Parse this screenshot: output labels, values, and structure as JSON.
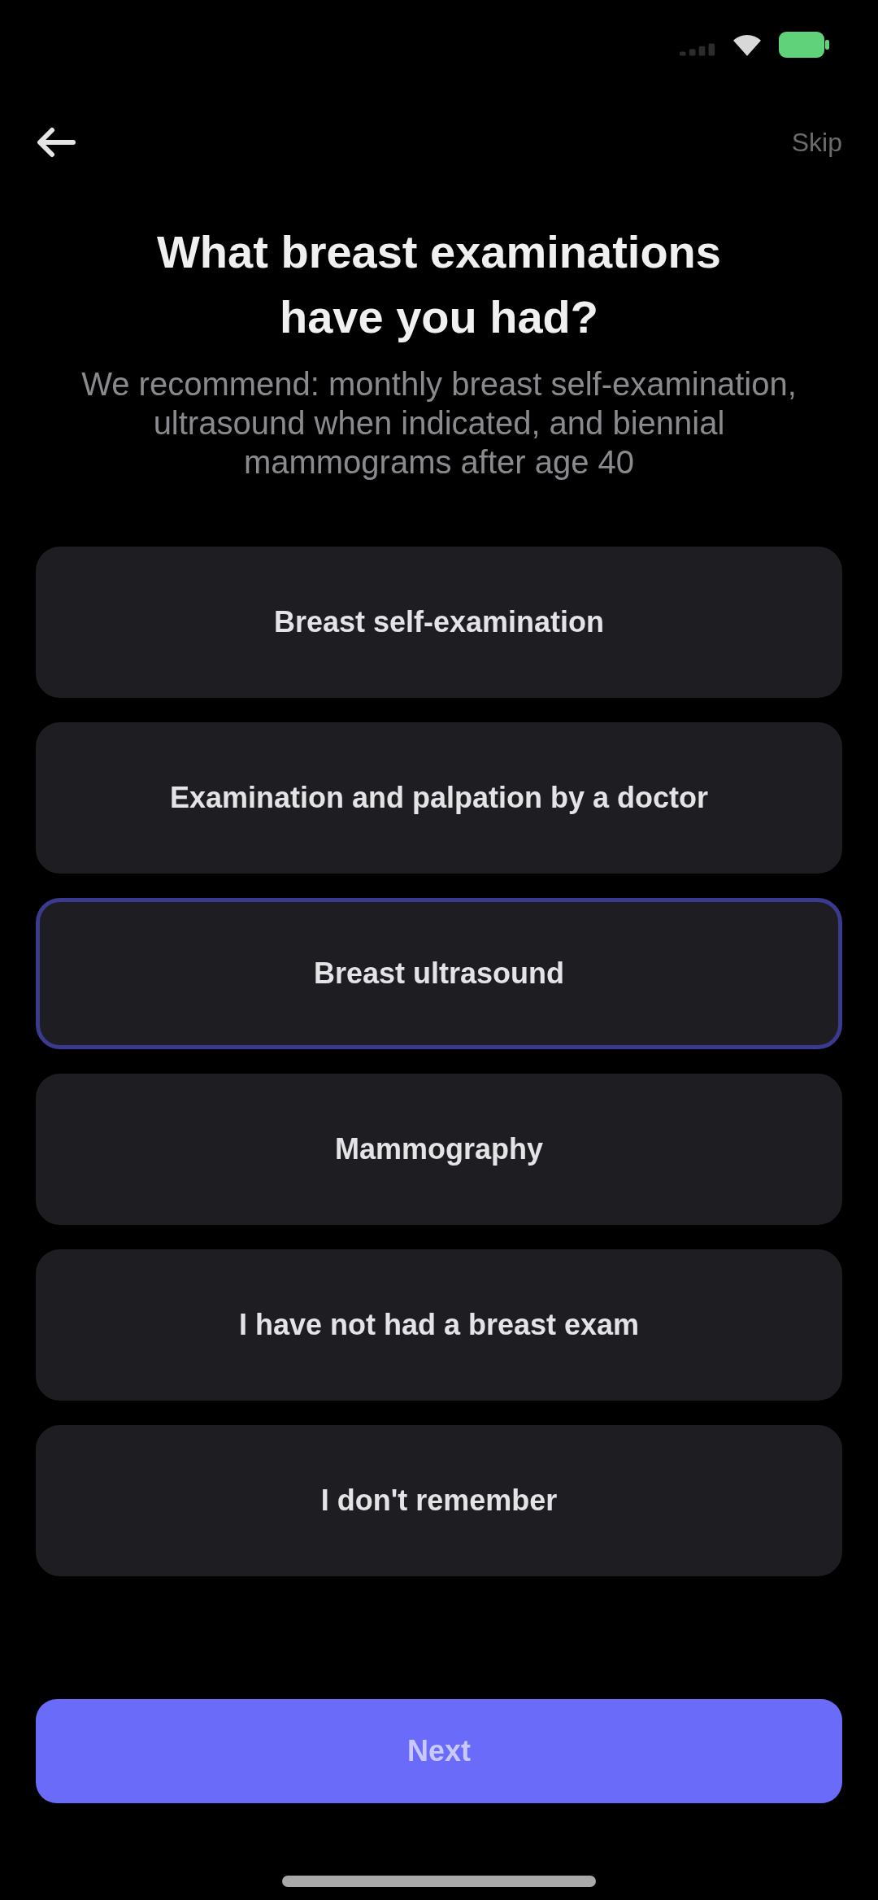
{
  "nav": {
    "skip_label": "Skip"
  },
  "question": {
    "title": "What breast examinations have you had?",
    "subtitle": "We recommend: monthly breast self-examination, ultrasound when indicated, and biennial mammograms after age 40"
  },
  "options": [
    {
      "label": "Breast self-examination",
      "selected": false
    },
    {
      "label": "Examination and palpation by a doctor",
      "selected": false
    },
    {
      "label": "Breast ultrasound",
      "selected": true
    },
    {
      "label": "Mammography",
      "selected": false
    },
    {
      "label": "I have not had a breast exam",
      "selected": false
    },
    {
      "label": "I don't remember",
      "selected": false
    }
  ],
  "next_button": {
    "label": "Next"
  }
}
